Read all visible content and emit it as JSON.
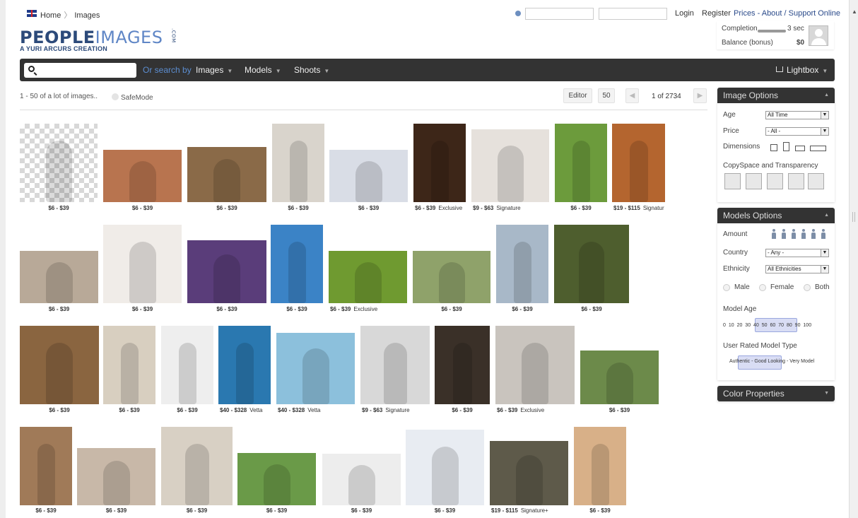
{
  "breadcrumb": {
    "home": "Home",
    "current": "Images"
  },
  "top": {
    "login": "Login",
    "register": "Register",
    "prices": "Prices - About / Support Online"
  },
  "logo": {
    "people": "PEOPLE",
    "images": "IMAGES",
    "dotcom": ".COM",
    "tagline": "A YURI ARCURS CREATION"
  },
  "account": {
    "completion_label": "Completion",
    "completion_value": "3 sec",
    "balance_label": "Balance (bonus)",
    "balance_value": "$0"
  },
  "nav": {
    "or_search_by": "Or search by",
    "images": "Images",
    "models": "Models",
    "shoots": "Shoots",
    "lightbox": "Lightbox",
    "search_placeholder": ""
  },
  "toolbar": {
    "result_info": "1 - 50 of a lot of images..",
    "safemode": "SafeMode",
    "editor": "Editor",
    "per_page": "50",
    "page": "1 of 2734"
  },
  "images": [
    {
      "price": "$6 - $39",
      "tag": "",
      "bg": "#cfcfcf"
    },
    {
      "price": "$6 - $39",
      "tag": "",
      "bg": "#b8744f"
    },
    {
      "price": "$6 - $39",
      "tag": "",
      "bg": "#8a6a48"
    },
    {
      "price": "$6 - $39",
      "tag": "",
      "bg": "#d9d4cc"
    },
    {
      "price": "$6 - $39",
      "tag": "",
      "bg": "#d9dde6"
    },
    {
      "price": "$6 - $39",
      "tag": "Exclusive",
      "bg": "#3d2618"
    },
    {
      "price": "$9 - $63",
      "tag": "Signature",
      "bg": "#e6e1dc"
    },
    {
      "price": "$6 - $39",
      "tag": "",
      "bg": "#6c9b3c"
    },
    {
      "price": "$19 - $115",
      "tag": "Signatur",
      "bg": "#b4652f"
    },
    {
      "price": "$6 - $39",
      "tag": "",
      "bg": "#b8a998"
    },
    {
      "price": "$6 - $39",
      "tag": "",
      "bg": "#f0ece8"
    },
    {
      "price": "$6 - $39",
      "tag": "",
      "bg": "#5a3d7a"
    },
    {
      "price": "$6 - $39",
      "tag": "",
      "bg": "#3b83c6"
    },
    {
      "price": "$6 - $39",
      "tag": "Exclusive",
      "bg": "#6f9a30"
    },
    {
      "price": "$6 - $39",
      "tag": "",
      "bg": "#8fa26a"
    },
    {
      "price": "$6 - $39",
      "tag": "",
      "bg": "#a8b8c8"
    },
    {
      "price": "$6 - $39",
      "tag": "",
      "bg": "#4e5e2e"
    },
    {
      "price": "$6 - $39",
      "tag": "",
      "bg": "#8a6540"
    },
    {
      "price": "$6 - $39",
      "tag": "",
      "bg": "#d8cfc0"
    },
    {
      "price": "$6 - $39",
      "tag": "",
      "bg": "#eeeeee"
    },
    {
      "price": "$40 - $328",
      "tag": "Vetta",
      "bg": "#2a78b0"
    },
    {
      "price": "$40 - $328",
      "tag": "Vetta",
      "bg": "#8cc0dc"
    },
    {
      "price": "$9 - $63",
      "tag": "Signature",
      "bg": "#d8d8d8"
    },
    {
      "price": "$6 - $39",
      "tag": "",
      "bg": "#3a3028"
    },
    {
      "price": "$6 - $39",
      "tag": "Exclusive",
      "bg": "#c9c4be"
    },
    {
      "price": "$6 - $39",
      "tag": "",
      "bg": "#6c8a4a"
    },
    {
      "price": "$6 - $39",
      "tag": "",
      "bg": "#a07a58"
    },
    {
      "price": "$6 - $39",
      "tag": "",
      "bg": "#c8b8a8"
    },
    {
      "price": "$6 - $39",
      "tag": "",
      "bg": "#d8d0c4"
    },
    {
      "price": "$6 - $39",
      "tag": "",
      "bg": "#6a9a48"
    },
    {
      "price": "$6 - $39",
      "tag": "",
      "bg": "#ededed"
    },
    {
      "price": "$6 - $39",
      "tag": "",
      "bg": "#e8ecf2"
    },
    {
      "price": "$19 - $115",
      "tag": "Signature+",
      "bg": "#5e5a4a"
    },
    {
      "price": "$6 - $39",
      "tag": "",
      "bg": "#d8b088"
    }
  ],
  "image_options": {
    "title": "Image Options",
    "age_label": "Age",
    "age_value": "All Time",
    "price_label": "Price",
    "price_value": "- All -",
    "dimensions_label": "Dimensions",
    "copyspace_label": "CopySpace and Transparency"
  },
  "models_options": {
    "title": "Models Options",
    "amount_label": "Amount",
    "country_label": "Country",
    "country_value": "- Any -",
    "ethnicity_label": "Ethnicity",
    "ethnicity_value": "All Ethnicities",
    "male": "Male",
    "female": "Female",
    "both": "Both",
    "model_age_label": "Model Age",
    "ages": "0 10 20 30 40 50 60 70 80 90 100",
    "rated_label": "User Rated Model Type",
    "rated_value": "Authentic - Good Looking - Very Model"
  },
  "color_properties": {
    "title": "Color Properties"
  },
  "colors": {
    "nav_bg": "#333333",
    "accent_blue": "#5c8ed1",
    "logo_blue": "#2c4a7a"
  }
}
